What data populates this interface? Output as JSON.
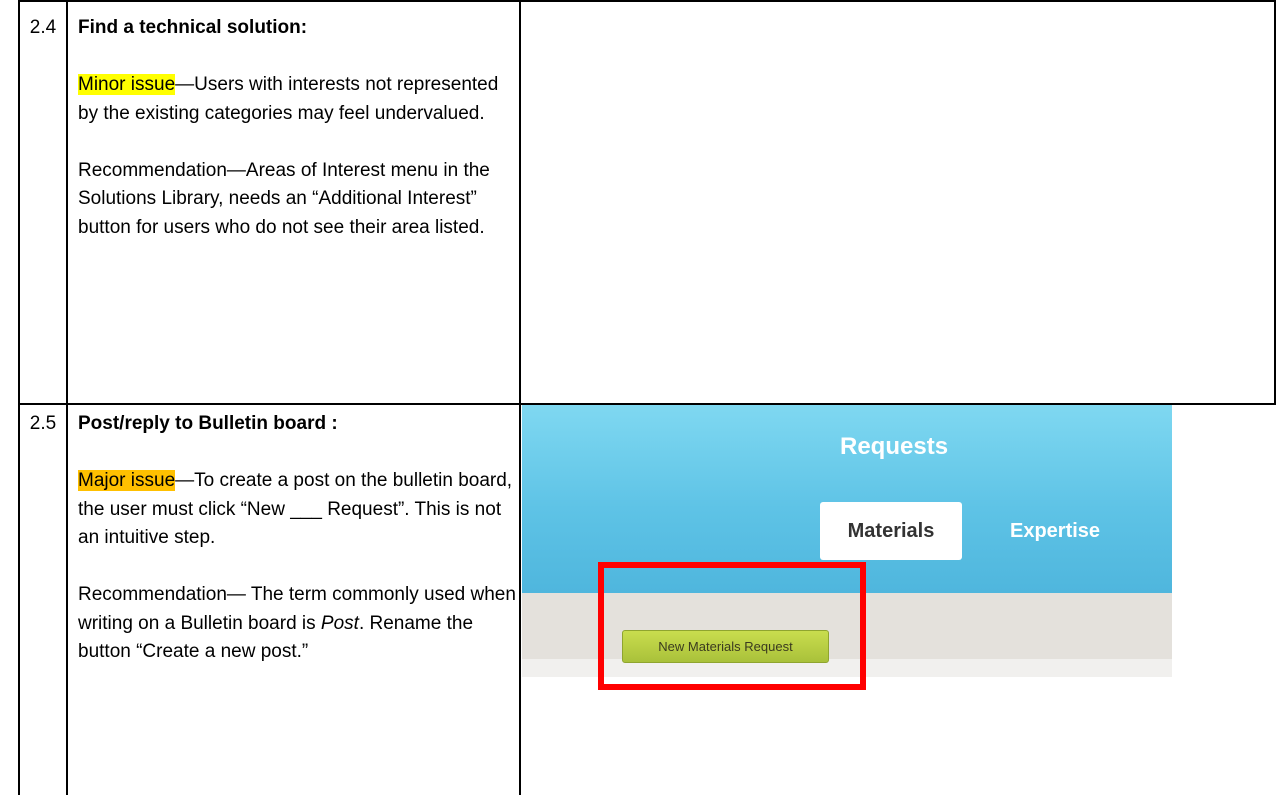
{
  "rows": [
    {
      "number": "2.4",
      "title": "Find a technical solution:",
      "issue_label": "Minor issue",
      "issue_text": "—Users with interests not represented by the existing categories may feel undervalued.",
      "recommendation": "Recommendation—Areas of Interest menu in the Solutions Library, needs an “Additional Interest” button for users who do not see their area listed."
    },
    {
      "number": "2.5",
      "title": "Post/reply to Bulletin board :",
      "issue_label": "Major issue",
      "issue_text": "—To create a post on the bulletin board, the user must click “New ___ Request”. This is not an intuitive step.",
      "recommendation_before": "Recommendation— The term commonly used when writing on a Bulletin board is ",
      "recommendation_emphasis": "Post",
      "recommendation_after": ". Rename the button “Create a new post.”"
    }
  ],
  "screenshot": {
    "header_title": "Requests",
    "tabs": [
      {
        "label": "Materials",
        "active": true
      },
      {
        "label": "Expertise",
        "active": false
      }
    ],
    "button_label": "New Materials Request",
    "highlight_color": "#ff0000"
  }
}
